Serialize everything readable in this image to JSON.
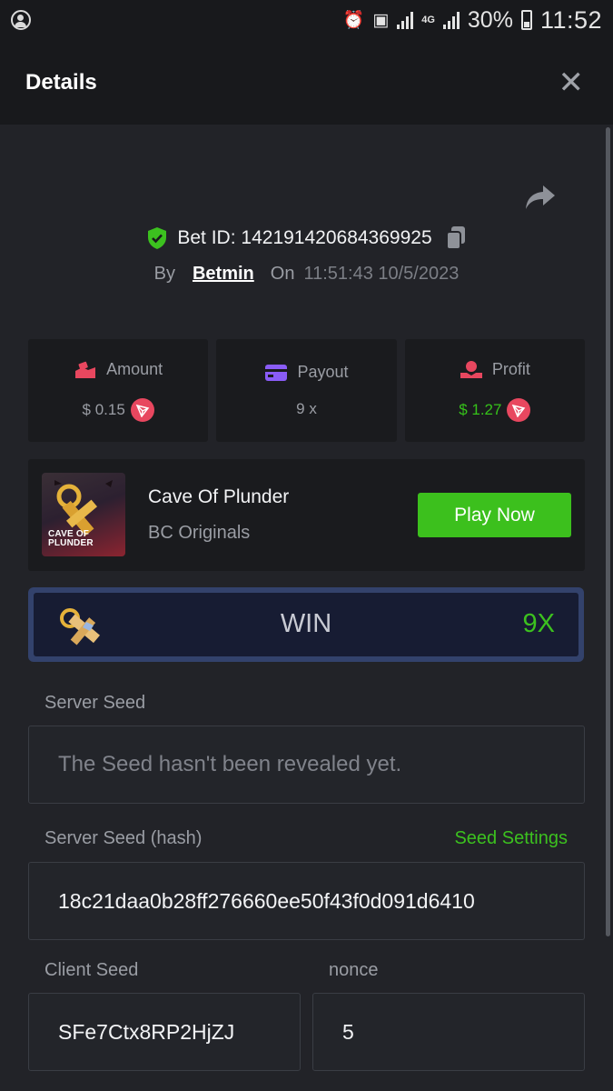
{
  "status_bar": {
    "battery": "30%",
    "time": "11:52",
    "network": "4G"
  },
  "header": {
    "title": "Details",
    "close_icon": "close-icon"
  },
  "bet": {
    "id_label": "Bet ID:",
    "id": "142191420684369925",
    "by_label": "By",
    "user": "Betmin",
    "on_label": "On",
    "datetime": "11:51:43 10/5/2023"
  },
  "stats": {
    "amount": {
      "label": "Amount",
      "value": "$ 0.15"
    },
    "payout": {
      "label": "Payout",
      "value": "9 x"
    },
    "profit": {
      "label": "Profit",
      "value": "$ 1.27"
    }
  },
  "game": {
    "name": "Cave Of Plunder",
    "provider": "BC Originals",
    "thumb_title_line1": "CAVE OF",
    "thumb_title_line2": "PLUNDER",
    "play_label": "Play Now"
  },
  "result": {
    "label": "WIN",
    "multiplier": "9X"
  },
  "server_seed": {
    "label": "Server Seed",
    "value": "The Seed hasn't been revealed yet."
  },
  "server_seed_hash": {
    "label": "Server Seed (hash)",
    "settings_label": "Seed Settings",
    "value": "18c21daa0b28ff276660ee50f43f0d091d6410"
  },
  "client_seed": {
    "label": "Client Seed",
    "value": "SFe7Ctx8RP2HjZJ"
  },
  "nonce": {
    "label": "nonce",
    "value": "5"
  },
  "colors": {
    "accent_green": "#3cc01d",
    "tron_red": "#e8475f",
    "payout_purple": "#8a5cf6"
  }
}
